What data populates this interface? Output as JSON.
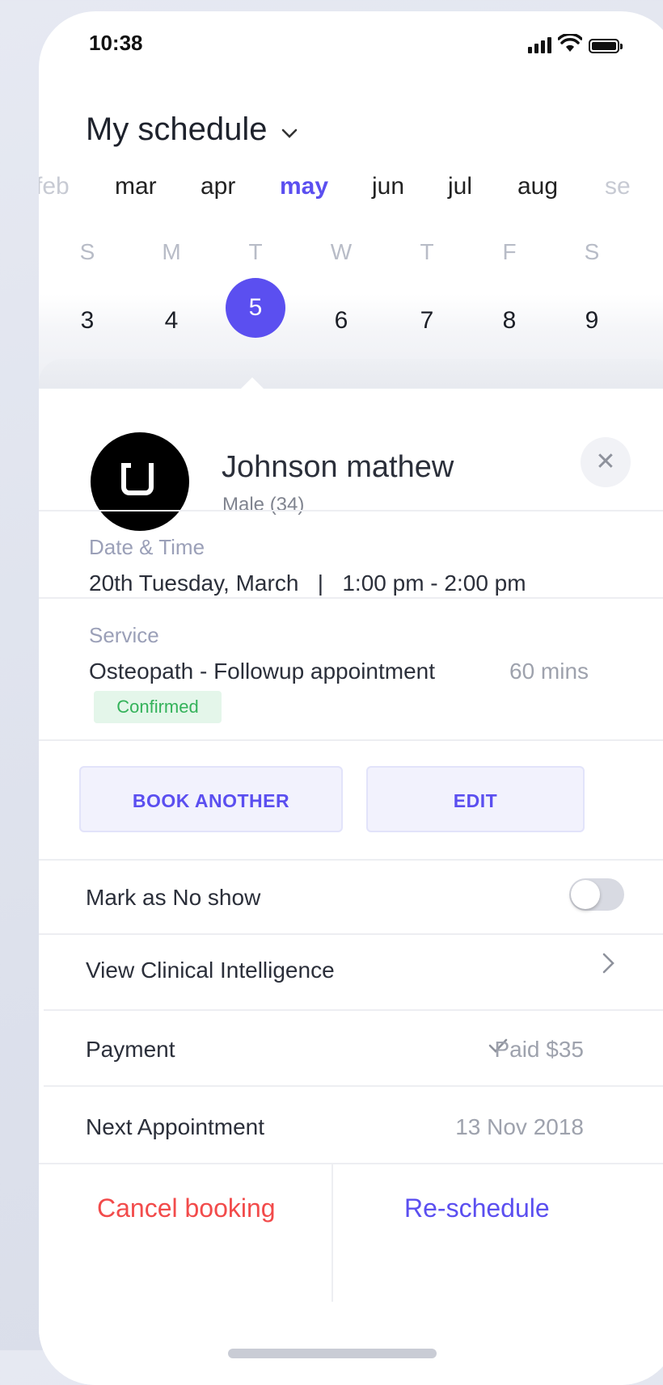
{
  "status_bar": {
    "time": "10:38",
    "signal_icon": "signal-icon",
    "wifi_icon": "wifi-icon",
    "battery_icon": "battery-icon"
  },
  "header": {
    "title": "My schedule",
    "dropdown_icon": "chevron-down-icon"
  },
  "months": [
    {
      "label": "feb",
      "state": "faded"
    },
    {
      "label": "mar",
      "state": "normal"
    },
    {
      "label": "apr",
      "state": "normal"
    },
    {
      "label": "may",
      "state": "active"
    },
    {
      "label": "jun",
      "state": "normal"
    },
    {
      "label": "jul",
      "state": "normal"
    },
    {
      "label": "aug",
      "state": "normal"
    },
    {
      "label": "se",
      "state": "faded"
    }
  ],
  "week": {
    "day_letters": [
      "S",
      "M",
      "T",
      "W",
      "T",
      "F",
      "S"
    ],
    "day_numbers": [
      "3",
      "4",
      "5",
      "6",
      "7",
      "8",
      "9"
    ],
    "selected_index": 2
  },
  "patient": {
    "name": "Johnson mathew",
    "details": "Male (34)",
    "avatar_icon": "uber-logo-icon",
    "close_icon": "close-icon"
  },
  "appointment": {
    "date_label": "Date & Time",
    "date_value": "20th Tuesday, March   |   1:00 pm - 2:00 pm",
    "service_label": "Service",
    "service_value": "Osteopath - Followup appointment",
    "duration": "60 mins",
    "status": "Confirmed"
  },
  "actions": {
    "book_another": "BOOK ANOTHER",
    "edit": "EDIT"
  },
  "rows": {
    "no_show": {
      "label": "Mark as No show",
      "toggle_on": false
    },
    "clinical": {
      "label": "View Clinical Intelligence",
      "icon": "chevron-right-icon"
    },
    "payment": {
      "label": "Payment",
      "value": "Paid $35",
      "icon": "check-icon"
    },
    "next_appointment": {
      "label": "Next Appointment",
      "value": "13 Nov 2018"
    }
  },
  "footer": {
    "cancel": "Cancel booking",
    "reschedule": "Re-schedule"
  },
  "colors": {
    "accent": "#5b4ff0",
    "danger": "#f24b4b",
    "success": "#34b25a"
  }
}
